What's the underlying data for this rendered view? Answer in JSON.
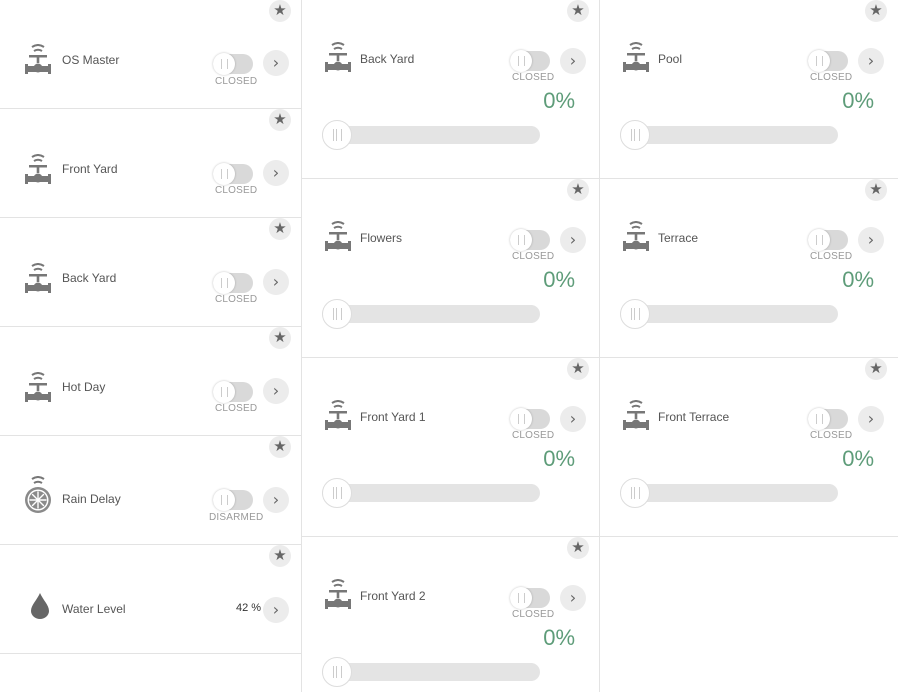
{
  "colors": {
    "accent_green": "#5e9c79",
    "divider": "#e3e3e3",
    "track": "#e4e4e4",
    "button_bg": "#ececec"
  },
  "icons": {
    "favorite": "star-icon",
    "open": "chevron-right-icon",
    "valve": "valve-icon",
    "rain": "rain-delay-icon",
    "water": "water-drop-icon"
  },
  "favorite_glyph": "★",
  "arrow_glyph": "›",
  "left_panel": [
    {
      "name": "OS Master",
      "state": "CLOSED"
    },
    {
      "name": "Front Yard",
      "state": "CLOSED"
    },
    {
      "name": "Back Yard",
      "state": "CLOSED"
    },
    {
      "name": "Hot Day",
      "state": "CLOSED"
    },
    {
      "name": "Rain Delay",
      "state": "DISARMED"
    },
    {
      "name": "Water Level",
      "value": "42 %"
    }
  ],
  "zones": [
    {
      "name": "Back Yard",
      "state": "CLOSED",
      "percent": "0%",
      "level": 0
    },
    {
      "name": "Pool",
      "state": "CLOSED",
      "percent": "0%",
      "level": 0
    },
    {
      "name": "Flowers",
      "state": "CLOSED",
      "percent": "0%",
      "level": 0
    },
    {
      "name": "Terrace",
      "state": "CLOSED",
      "percent": "0%",
      "level": 0
    },
    {
      "name": "Front Yard 1",
      "state": "CLOSED",
      "percent": "0%",
      "level": 0
    },
    {
      "name": "Front Terrace",
      "state": "CLOSED",
      "percent": "0%",
      "level": 0
    },
    {
      "name": "Front Yard 2",
      "state": "CLOSED",
      "percent": "0%",
      "level": 0
    }
  ]
}
